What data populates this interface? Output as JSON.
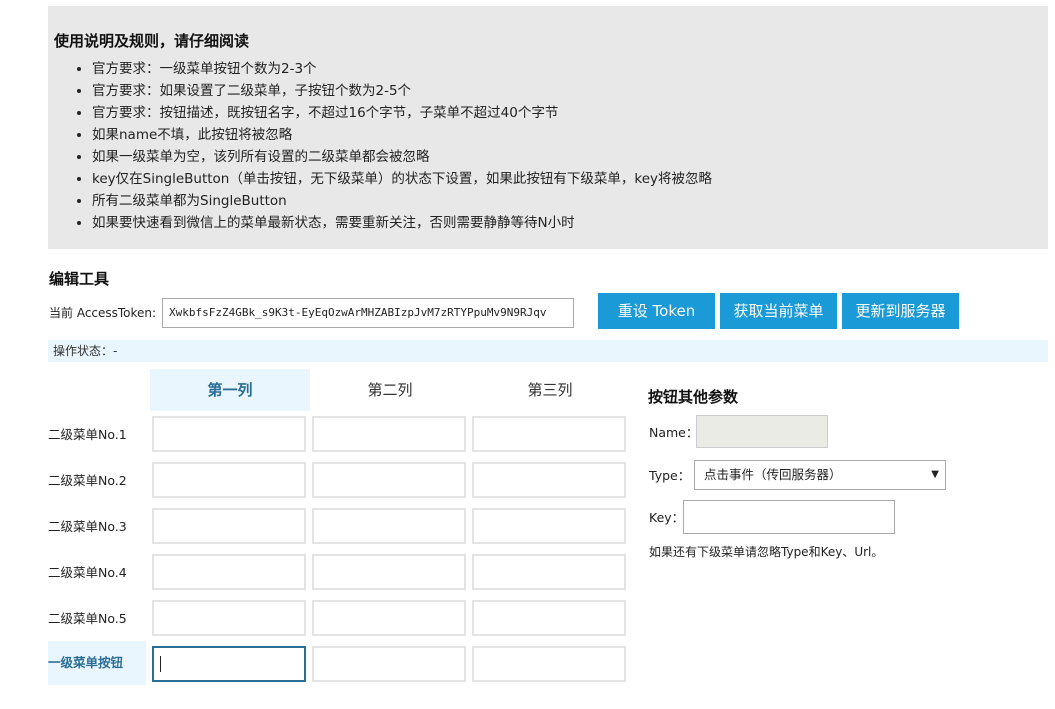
{
  "notice": {
    "title": "使用说明及规则，请仔细阅读",
    "items": [
      "官方要求：一级菜单按钮个数为2-3个",
      "官方要求：如果设置了二级菜单，子按钮个数为2-5个",
      "官方要求：按钮描述，既按钮名字，不超过16个字节，子菜单不超过40个字节",
      "如果name不填，此按钮将被忽略",
      "如果一级菜单为空，该列所有设置的二级菜单都会被忽略",
      "key仅在SingleButton（单击按钮，无下级菜单）的状态下设置，如果此按钮有下级菜单，key将被忽略",
      "所有二级菜单都为SingleButton",
      "如果要快速看到微信上的菜单最新状态，需要重新关注，否则需要静静等待N小时"
    ]
  },
  "editor": {
    "title": "编辑工具",
    "token_label": "当前 AccessToken:",
    "token_value": "XwkbfsFzZ4GBk_s9K3t-EyEqOzwArMHZABIzpJvM7zRTYPpuMv9N9RJqv",
    "buttons": {
      "reset_token": "重设 Token",
      "get_menu": "获取当前菜单",
      "update_server": "更新到服务器"
    },
    "status": "操作状态：-"
  },
  "grid": {
    "columns": [
      "第一列",
      "第二列",
      "第三列"
    ],
    "active_column": 0,
    "rows": [
      "二级菜单No.1",
      "二级菜单No.2",
      "二级菜单No.3",
      "二级菜单No.4",
      "二级菜单No.5",
      "一级菜单按钮"
    ],
    "active_row": 5
  },
  "params": {
    "title": "按钮其他参数",
    "name_label": "Name：",
    "name_value": "",
    "type_label": "Type：",
    "type_selected": "点击事件（传回服务器）",
    "key_label": "Key：",
    "key_value": "",
    "hint": "如果还有下级菜单请忽略Type和Key、Url。"
  },
  "colors": {
    "accent": "#1a9ad6",
    "active_bg": "#e9f6fd",
    "active_text": "#2a6e96",
    "notice_bg": "#e8e8e8"
  }
}
